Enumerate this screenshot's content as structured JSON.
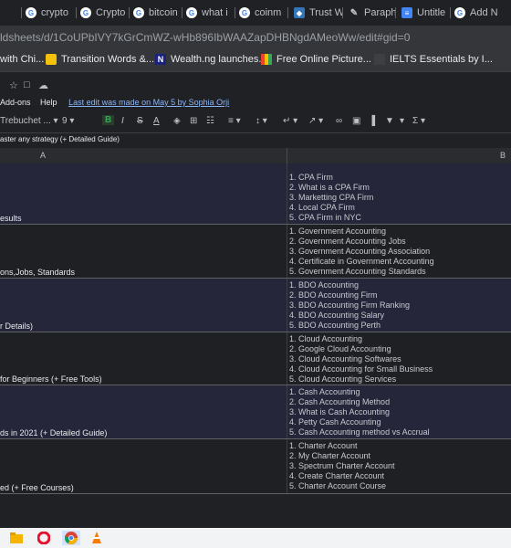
{
  "browser": {
    "tabs": [
      {
        "label": "l",
        "icon": "google-icon"
      },
      {
        "label": "crypto",
        "icon": "google-icon"
      },
      {
        "label": "Crypto",
        "icon": "google-icon"
      },
      {
        "label": "bitcoin",
        "icon": "google-icon"
      },
      {
        "label": "what i",
        "icon": "google-icon"
      },
      {
        "label": "coinm",
        "icon": "google-icon"
      },
      {
        "label": "Trust W",
        "icon": "shield-icon"
      },
      {
        "label": "Paraph",
        "icon": "pen-icon"
      },
      {
        "label": "Untitle",
        "icon": "docs-icon"
      },
      {
        "label": "Add N",
        "icon": "google-icon"
      }
    ],
    "url": "ldsheets/d/1CoUPbIVY7kGrCmWZ-wHb896IbWAAZapDHBNgdAMeoWw/edit#gid=0",
    "bookmarks": [
      {
        "label": "with Chi...",
        "icon": "none"
      },
      {
        "label": "Transition Words &...",
        "icon": "transition-words-icon"
      },
      {
        "label": "Wealth.ng launches...",
        "icon": "wealth-ng-icon"
      },
      {
        "label": "Free Online Picture...",
        "icon": "picture-icon"
      },
      {
        "label": "IELTS Essentials by I...",
        "icon": "ielts-icon"
      }
    ]
  },
  "sheet": {
    "menu": {
      "addons": "Add-ons",
      "help": "Help",
      "last_edit": "Last edit was made on May 5 by Sophia Orji"
    },
    "toolbar": {
      "font": "Trebuchet ...",
      "size": "9",
      "bold": "B",
      "italic": "I",
      "strike": "S",
      "text_color": "A"
    },
    "formula": "aster any strategy (+ Detailed Guide)",
    "columns": {
      "a": "A",
      "b": "B"
    },
    "rows": [
      {
        "a": "esults",
        "keywords": [
          "1. CPA Firm",
          "2. What is a CPA Firm",
          "3. Marketting CPA Firm",
          "4. Local CPA Firm",
          "5. CPA Firm in NYC"
        ]
      },
      {
        "a": "ons,Jobs, Standards",
        "keywords": [
          "1. Government Accounting",
          "2. Government Accounting Jobs",
          "3. Government Accounting Association",
          "4. Certificate in Government Accounting",
          "5. Government Accounting Standards"
        ]
      },
      {
        "a": "r Details)",
        "keywords": [
          "1. BDO Accounting",
          "2. BDO Accounting Firm",
          "3. BDO Accounting Firm Ranking",
          "4. BDO Accounting Salary",
          "5. BDO Accounting Perth"
        ]
      },
      {
        "a": "for Beginners (+ Free Tools)",
        "keywords": [
          "1. Cloud Accounting",
          "2. Google Cloud Accounting",
          "3. Cloud Accounting Softwares",
          "4. Cloud Accounting for Small Business",
          "5. Cloud Accounting Services"
        ]
      },
      {
        "a": "ds in 2021 (+ Detailed Guide)",
        "keywords": [
          "1. Cash Accounting",
          "2. Cash Accounting Method",
          "3. What is Cash Accounting",
          "4. Petty Cash Accounting",
          "5. Cash Accounting method vs Accrual"
        ]
      },
      {
        "a": "ed (+ Free Courses)",
        "keywords": [
          "1. Charter Account",
          "2. My Charter Account",
          "3. Spectrum Charter Account",
          "4. Create Charter Account",
          "5. Charter Account Course"
        ]
      }
    ]
  },
  "taskbar": {
    "icons": [
      "file-explorer-icon",
      "opera-icon",
      "chrome-icon",
      "vlc-icon"
    ]
  }
}
